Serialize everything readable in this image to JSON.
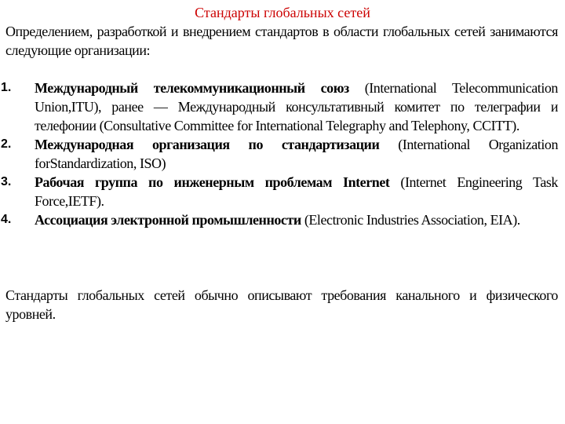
{
  "title": "Стандарты глобальных сетей",
  "title_color": "#cc0000",
  "intro": "Определением, разработкой и внедрением стандартов в области глобальных сетей занимаются следующие организации:",
  "organizations": [
    {
      "number": "1.",
      "name": "Международный телекоммуникационный союз",
      "description": " (International Telecommunication Union,ITU), ранее — Международный консультативный комитет по телеграфии и телефонии (Consultative Committee for International Telegraphy and Telephony, CCITT)."
    },
    {
      "number": "2.",
      "name": "Международная организация по стандартизации",
      "description": " (International Organization forStandardization, ISO)"
    },
    {
      "number": "3.",
      "name": "Рабочая группа по инженерным проблемам Internet",
      "description": " (Internet Engineering Task Force,IETF)."
    },
    {
      "number": "4.",
      "name": "Ассоциация электронной промышленности",
      "description": " (Electronic Industries Association, EIA)."
    }
  ],
  "conclusion": "Стандарты глобальных сетей обычно описывают требования канального и физического уровней."
}
